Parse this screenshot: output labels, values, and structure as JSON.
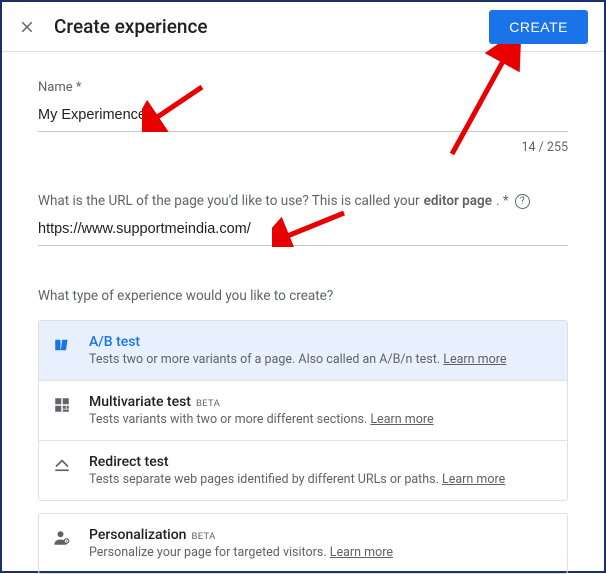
{
  "header": {
    "title": "Create experience",
    "create_label": "CREATE"
  },
  "name_field": {
    "label": "Name *",
    "value": "My Experimence",
    "counter": "14 / 255"
  },
  "url_field": {
    "label_pre": "What is the URL of the page you'd like to use? This is called your",
    "label_bold": "editor page",
    "label_post": ". *",
    "value": "https://www.supportmeindia.com/"
  },
  "type_section": {
    "heading": "What type of experience would you like to create?",
    "options": [
      {
        "title": "A/B test",
        "desc": "Tests two or more variants of a page. Also called an A/B/n test.",
        "learn": "Learn more",
        "beta": false,
        "selected": true,
        "icon": "ab-test-icon"
      },
      {
        "title": "Multivariate test",
        "desc": "Tests variants with two or more different sections.",
        "learn": "Learn more",
        "beta": true,
        "selected": false,
        "icon": "multivariate-icon"
      },
      {
        "title": "Redirect test",
        "desc": "Tests separate web pages identified by different URLs or paths.",
        "learn": "Learn more",
        "beta": false,
        "selected": false,
        "icon": "redirect-icon"
      }
    ],
    "personalization": {
      "title": "Personalization",
      "desc": "Personalize your page for targeted visitors.",
      "learn": "Learn more",
      "beta": true,
      "icon": "personalization-icon"
    }
  }
}
